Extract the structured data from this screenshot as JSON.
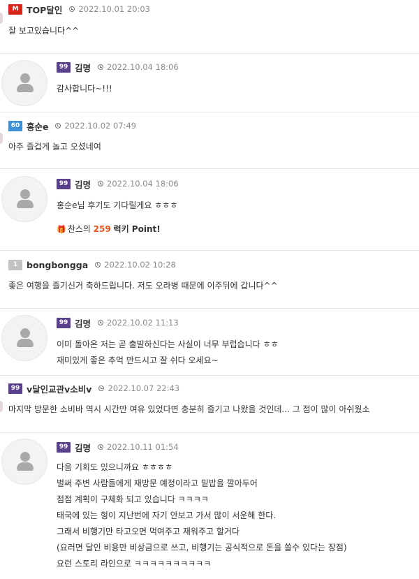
{
  "comments": [
    {
      "level": "M",
      "nick": "TOP달인",
      "date": "2022.10.01 20:03",
      "lines": [
        "잘 보고있습니다^^"
      ]
    },
    {
      "level": "99",
      "nick": "김명",
      "date": "2022.10.04 18:06",
      "lines": [
        "감사합니다~!!!"
      ]
    },
    {
      "level": "60",
      "nick": "홍순e",
      "date": "2022.10.02 07:49",
      "lines": [
        "아주 즐겁게 놀고 오셨네여"
      ]
    },
    {
      "level": "99",
      "nick": "김명",
      "date": "2022.10.04 18:06",
      "lines": [
        "홍순e님 후기도 기다릴게요 ㅎㅎㅎ"
      ],
      "lucky": {
        "prefix": "찬스의",
        "points": "259",
        "suffix": "럭키 Point!"
      }
    },
    {
      "level": "1",
      "nick": "bongbongga",
      "date": "2022.10.02 10:28",
      "lines": [
        "좋은 여행을 즐기신거 축하드립니다. 저도 오라병 때문에 이주뒤에 갑니다^^"
      ]
    },
    {
      "level": "99",
      "nick": "김명",
      "date": "2022.10.02 11:13",
      "lines": [
        "이미 돌아온 저는 곧 출발하신다는 사실이 너무 부럽습니다 ㅎㅎ",
        "재미있게 좋은 추억 만드시고 잘 쉬다 오세요~"
      ]
    },
    {
      "level": "99",
      "nick": "v달인교관v소비v",
      "date": "2022.10.07 22:43",
      "lines": [
        "마지막 방문한 소비바 역시 시간만 여유 있었다면 충분히 즐기고 나왔을 것인데... 그 점이 많이 아쉬웠소"
      ]
    },
    {
      "level": "99",
      "nick": "김명",
      "date": "2022.10.11 01:54",
      "lines": [
        "다음 기회도 있으니까요 ㅎㅎㅎㅎ",
        "벌써 주변 사람들에게 재방문 예정이라고 밑밥을 깔아두어",
        "점점 계획이 구체화 되고 있습니다 ㅋㅋㅋㅋ",
        "태국에 있는 형이 지난번에 자기 안보고 가서 많이 서운해 한다.",
        "그래서 비행기만 타고오면 먹여주고 재워주고 할거다",
        "(요러면 달인 비용만 비상금으로 쓰고, 비행기는 공식적으로 돈을 쓸수 있다는 장점)",
        "요런 스토리 라인으로 ㅋㅋㅋㅋㅋㅋㅋㅋㅋㅋ"
      ]
    }
  ],
  "colors": {
    "level_m": "#d9261c",
    "level_99": "#5a3f8c",
    "level_60": "#3d8fd6",
    "level_1": "#c2c2c2",
    "points": "#e8561f"
  }
}
